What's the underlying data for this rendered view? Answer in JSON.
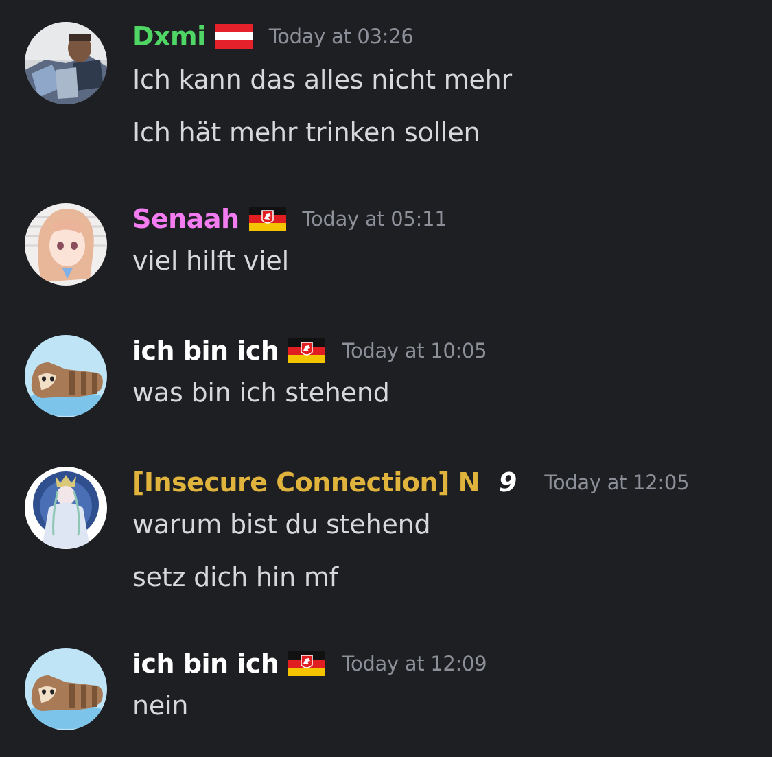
{
  "messages": [
    {
      "author": "Dxmi",
      "author_color": "#4fd665",
      "flag": "austria-flag-icon",
      "timestamp": "Today at 03:26",
      "avatar": "armored-soldier-avatar",
      "lines": [
        "Ich kann das alles nicht mehr",
        "Ich hät mehr trinken sollen"
      ]
    },
    {
      "author": "Senaah",
      "author_color": "#f37cf1",
      "flag": "lower-saxony-flag-icon",
      "timestamp": "Today at 05:11",
      "avatar": "anime-girl-avatar",
      "lines": [
        "viel hilft viel"
      ]
    },
    {
      "author": "ich bin ich",
      "author_color": "#ffffff",
      "flag": "lower-saxony-flag-icon",
      "timestamp": "Today at 10:05",
      "avatar": "furret-avatar",
      "lines": [
        "was bin ich stehend"
      ]
    },
    {
      "author": "[Insecure Connection] N",
      "author_color": "#e0b43c",
      "badge": "9",
      "timestamp": "Today at 12:05",
      "avatar": "crowned-figure-avatar",
      "lines": [
        "warum bist du stehend",
        "setz dich hin mf"
      ]
    },
    {
      "author": "ich bin ich",
      "author_color": "#ffffff",
      "flag": "lower-saxony-flag-icon",
      "timestamp": "Today at 12:09",
      "avatar": "furret-avatar",
      "lines": [
        "nein"
      ]
    }
  ]
}
